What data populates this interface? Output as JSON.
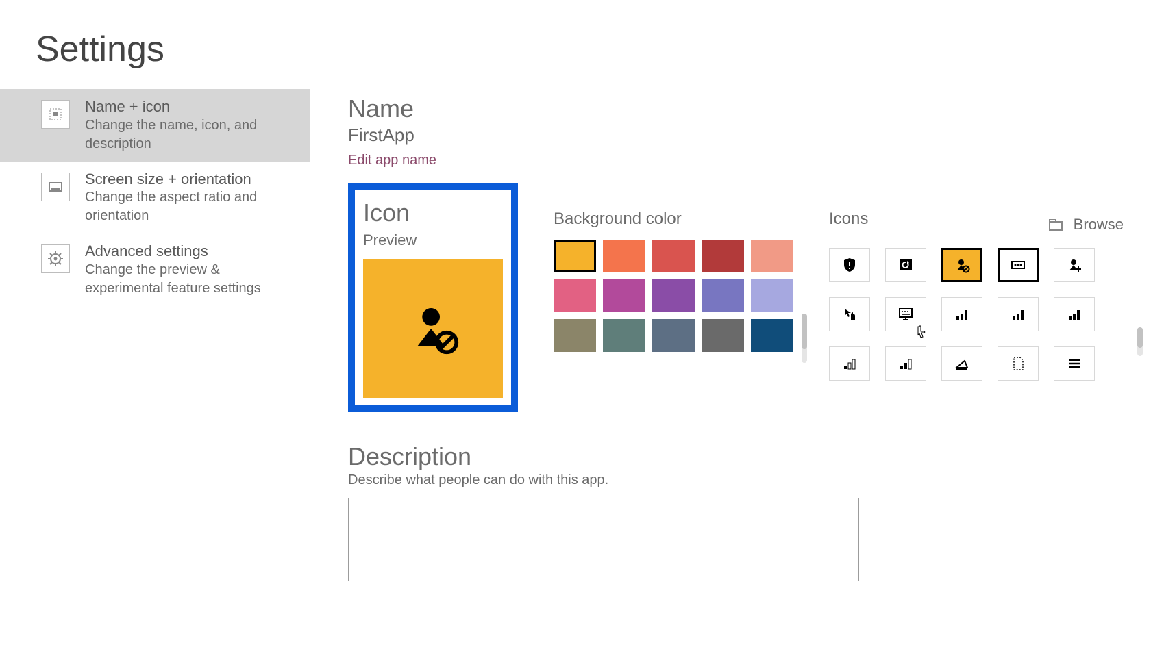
{
  "page_title": "Settings",
  "sidebar": {
    "items": [
      {
        "icon": "grid-icon",
        "title": "Name + icon",
        "subtitle": "Change the name, icon, and description",
        "selected": true
      },
      {
        "icon": "screen-icon",
        "title": "Screen size + orientation",
        "subtitle": "Change the aspect ratio and orientation",
        "selected": false
      },
      {
        "icon": "gear-icon",
        "title": "Advanced settings",
        "subtitle": "Change the preview & experimental feature settings",
        "selected": false
      }
    ]
  },
  "name_section": {
    "heading": "Name",
    "app_name": "FirstApp",
    "edit_link": "Edit app name"
  },
  "icon_section": {
    "heading": "Icon",
    "preview_label": "Preview",
    "selected_icon": "user-blocked-icon",
    "selected_bg": "#f5b22b"
  },
  "bg_section": {
    "heading": "Background color",
    "colors": [
      "#f5b22b",
      "#f4744c",
      "#d9544f",
      "#b23a3a",
      "#f19a86",
      "#e26183",
      "#b24a9b",
      "#8a4da7",
      "#7876c1",
      "#a6a8e0",
      "#8b8569",
      "#5f7e7a",
      "#5d6f84",
      "#6a6a6a",
      "#104d7a"
    ],
    "selected_index": 0
  },
  "icons_section": {
    "heading": "Icons",
    "browse_label": "Browse",
    "icons": [
      "shield-alert-icon",
      "refresh-panel-icon",
      "user-blocked-icon",
      "dots-box-icon",
      "user-add-icon",
      "pointer-hand-icon",
      "keyboard-screen-icon",
      "bars-small-icon",
      "bars-med-icon",
      "bars-large-icon",
      "bars-1-icon",
      "bars-2-icon",
      "scanner-icon",
      "page-dotted-icon",
      "menu-lines-icon"
    ],
    "selected_index": 2,
    "sub_selected_index": 3
  },
  "description_section": {
    "heading": "Description",
    "hint": "Describe what people can do with this app.",
    "value": ""
  }
}
